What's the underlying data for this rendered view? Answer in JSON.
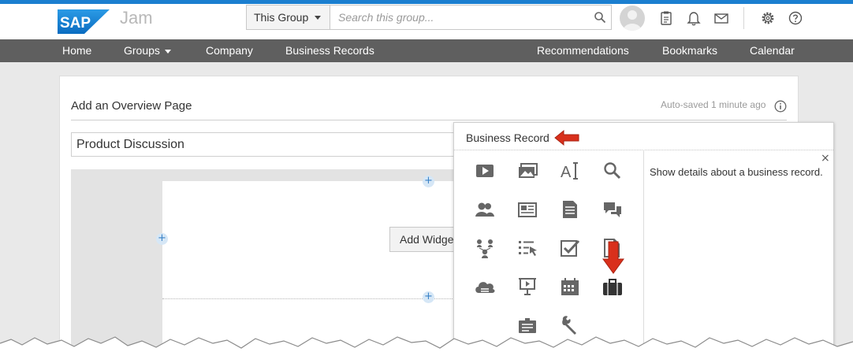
{
  "app": {
    "logo_text": "SAP",
    "product": "Jam"
  },
  "header": {
    "scope_label": "This Group",
    "search_placeholder": "Search this group...",
    "colors": {
      "top_strip": "#1b7fd0",
      "nav_bg": "#5f5f5f"
    }
  },
  "nav": {
    "items": [
      "Home",
      "Groups",
      "Company",
      "Business Records",
      "Recommendations",
      "Bookmarks",
      "Calendar"
    ]
  },
  "page": {
    "title": "Add an Overview Page",
    "autosave": "Auto-saved 1 minute ago",
    "title_value": "Product Discussion",
    "add_widget_label": "Add Widget"
  },
  "widget_picker": {
    "title": "Business Record",
    "description": "Show details about a business record.",
    "close_glyph": "×",
    "selected": "business-record",
    "icons": [
      "video-icon",
      "image-gallery-icon",
      "text-icon",
      "search-icon",
      "members-icon",
      "news-icon",
      "document-icon",
      "discussion-icon",
      "org-chart-icon",
      "task-list-icon",
      "checkmark-icon",
      "file-icon",
      "cloud-icon",
      "presentation-icon",
      "calendar-icon",
      "briefcase-icon",
      "business-card-icon",
      "wrench-icon"
    ],
    "annotation_color": "#d9301c"
  }
}
